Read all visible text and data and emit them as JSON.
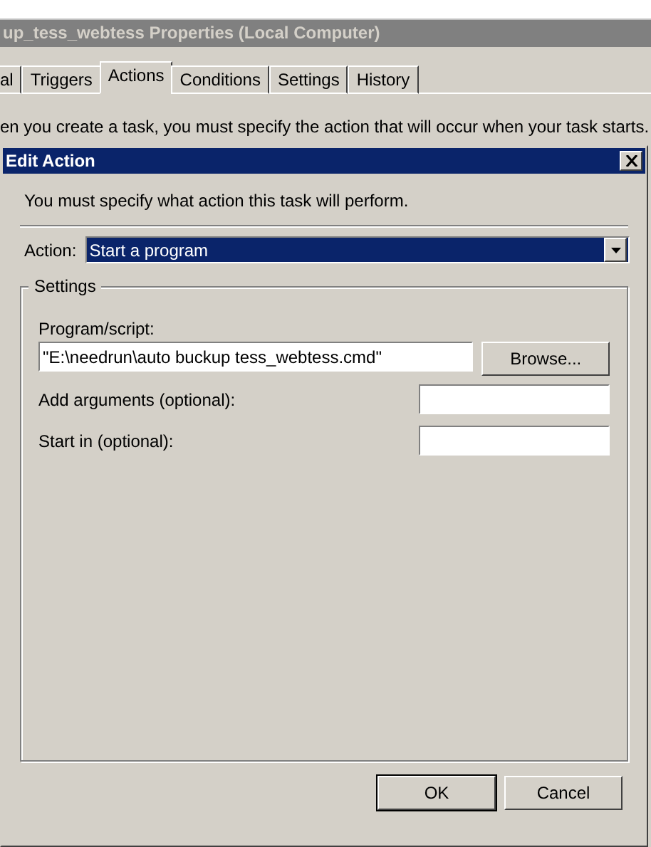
{
  "window": {
    "title": "up_tess_webtess Properties (Local Computer)"
  },
  "tabs": [
    {
      "label": "al",
      "selected": false
    },
    {
      "label": "Triggers",
      "selected": false
    },
    {
      "label": "Actions",
      "selected": true
    },
    {
      "label": "Conditions",
      "selected": false
    },
    {
      "label": "Settings",
      "selected": false
    },
    {
      "label": "History",
      "selected": false
    }
  ],
  "description": "en you create a task, you must specify the action that will occur when your task starts.",
  "dialog": {
    "title": "Edit Action",
    "instruction": "You must specify what action this task will perform.",
    "action": {
      "label": "Action:",
      "value": "Start a program"
    },
    "settings": {
      "legend": "Settings",
      "program": {
        "label": "Program/script:",
        "value": "\"E:\\needrun\\auto buckup tess_webtess.cmd\"",
        "button": "Browse..."
      },
      "arguments": {
        "label": "Add arguments (optional):"
      },
      "start_in": {
        "label": "Start in (optional):"
      }
    },
    "buttons": [
      {
        "label": "OK",
        "default": true
      },
      {
        "label": "Cancel",
        "default": false
      }
    ]
  }
}
